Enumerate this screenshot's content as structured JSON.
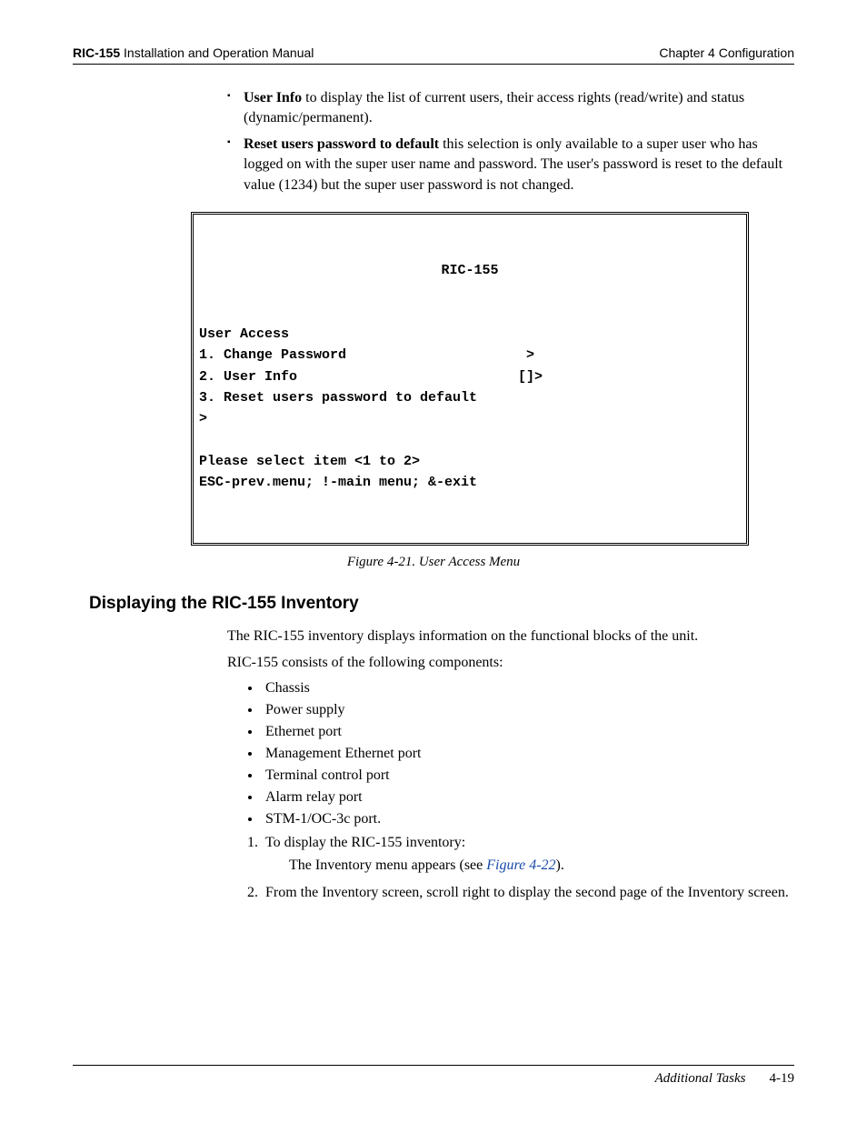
{
  "header": {
    "left_bold": "RIC-155",
    "left_rest": " Installation and Operation Manual",
    "right": "Chapter 4  Configuration"
  },
  "top_bullets": [
    {
      "bold": "User Info",
      "rest": " to display the list of current users, their access rights (read/write) and status (dynamic/permanent)."
    },
    {
      "bold": "Reset users password to default",
      "rest": " this selection is only available to a super user who has logged on with the super user name and password. The user's password is reset to the default value (1234) but the super user password is not changed."
    }
  ],
  "terminal": {
    "title": "RIC-155",
    "lines": [
      "User Access",
      "1. Change Password                      >",
      "2. User Info                           []>",
      "3. Reset users password to default",
      ">",
      "",
      "Please select item <1 to 2>",
      "ESC-prev.menu; !-main menu; &-exit"
    ]
  },
  "figure_caption": "Figure 4-21.  User Access Menu",
  "section_heading": "Displaying the RIC-155 Inventory",
  "para1": "The RIC-155 inventory displays information on the functional blocks of the unit.",
  "para2": "RIC-155 consists of the following components:",
  "components": [
    "Chassis",
    "Power supply",
    "Ethernet port",
    "Management Ethernet port",
    "Terminal control port",
    "Alarm relay port",
    "STM-1/OC-3c port."
  ],
  "steps": [
    {
      "text": "To display the RIC-155 inventory:",
      "sub_pre": "The Inventory menu appears (see ",
      "sub_link": "Figure 4-22",
      "sub_post": ")."
    },
    {
      "text": "From the Inventory screen, scroll right to display the second page of the Inventory screen."
    }
  ],
  "footer": {
    "label": "Additional Tasks",
    "page": "4-19"
  }
}
